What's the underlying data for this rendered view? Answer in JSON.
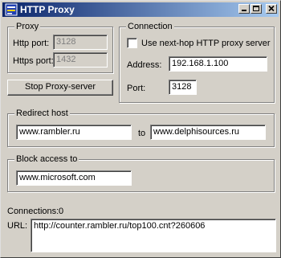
{
  "window": {
    "title": "HTTP Proxy"
  },
  "proxy": {
    "legend": "Proxy",
    "http_label": "Http port:",
    "http_value": "3128",
    "https_label": "Https port:",
    "https_value": "1432"
  },
  "stop_button": "Stop Proxy-server",
  "connection": {
    "legend": "Connection",
    "use_next_hop_label": "Use next-hop HTTP proxy server",
    "use_next_hop_checked": false,
    "address_label": "Address:",
    "address_value": "192.168.1.100",
    "port_label": "Port:",
    "port_value": "3128"
  },
  "redirect": {
    "legend": "Redirect host",
    "from_value": "www.rambler.ru",
    "to_label": "to",
    "to_value": "www.delphisources.ru"
  },
  "block": {
    "legend": "Block access to",
    "value": "www.microsoft.com"
  },
  "status": {
    "connections_label": "Connections:",
    "connections_value": "0",
    "url_label": "URL:",
    "url_value": "http://counter.rambler.ru/top100.cnt?260606"
  }
}
